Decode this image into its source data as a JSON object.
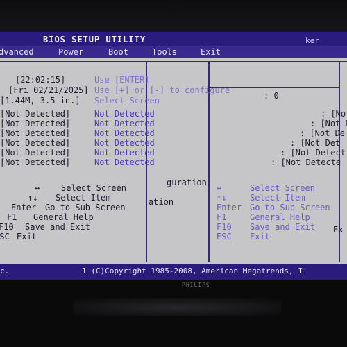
{
  "titlebar": {
    "title": "BIOS SETUP UTILITY",
    "right_text": "ker"
  },
  "menu": [
    {
      "label": "dvanced"
    },
    {
      "label": "Power"
    },
    {
      "label": "Boot"
    },
    {
      "label": "Tools"
    },
    {
      "label": "Exit"
    }
  ],
  "system": {
    "time": "[22:02:15]",
    "date": "[Fri 02/21/2025]",
    "floppy": "[1.44M, 3.5 in.]"
  },
  "blurred_values": {
    "time": "Use [ENTER]",
    "date": "Use [+] or [-] to configure",
    "floppy": "Select Screen"
  },
  "drives_left": [
    "[Not Detected]",
    "[Not Detected]",
    "[Not Detected]",
    "[Not Detected]",
    "[Not Detected]",
    "[Not Detected]"
  ],
  "drives_mid": [
    "Not Detected",
    "Not Detected",
    "Not Detected",
    "Not Detected",
    "Not Detected",
    "Not Detected"
  ],
  "drives_right": [
    ": [Not",
    ": [Not D",
    ": [Not De",
    ": [Not Det",
    ": [Not Detect",
    ": [Not Detecte"
  ],
  "right_misc": ": 0",
  "center_fragments": {
    "configuration": "guration",
    "information": "ation"
  },
  "help_left": [
    {
      "key": "↔",
      "desc": "Select Screen"
    },
    {
      "key": "↑↓",
      "desc": "Select Item"
    },
    {
      "key": "Enter",
      "desc": "Go to Sub Screen"
    },
    {
      "key": "F1",
      "desc": "General Help"
    },
    {
      "key": "F10",
      "desc": "Save and Exit"
    },
    {
      "key": "ESC",
      "desc": "Exit"
    }
  ],
  "help_right": [
    {
      "key": "↔",
      "desc": "Select Screen"
    },
    {
      "key": "↑↓",
      "desc": "Select Item"
    },
    {
      "key": "Enter",
      "desc": "Go to Sub Screen"
    },
    {
      "key": "F1",
      "desc": "General Help"
    },
    {
      "key": "F10",
      "desc": "Save and Exit"
    },
    {
      "key": "ESC",
      "desc": "Exit"
    }
  ],
  "help_right_extra": "Ex",
  "footer": {
    "left": "c.",
    "copyright": "1 (C)Copyright 1985-2008, American Megatrends, I"
  },
  "monitor": {
    "brand": "PHILIPS"
  },
  "colors": {
    "title_bar": "#2a1c7c",
    "screen_bg": "#c6c6c8",
    "value_text": "#4b3bbd"
  }
}
